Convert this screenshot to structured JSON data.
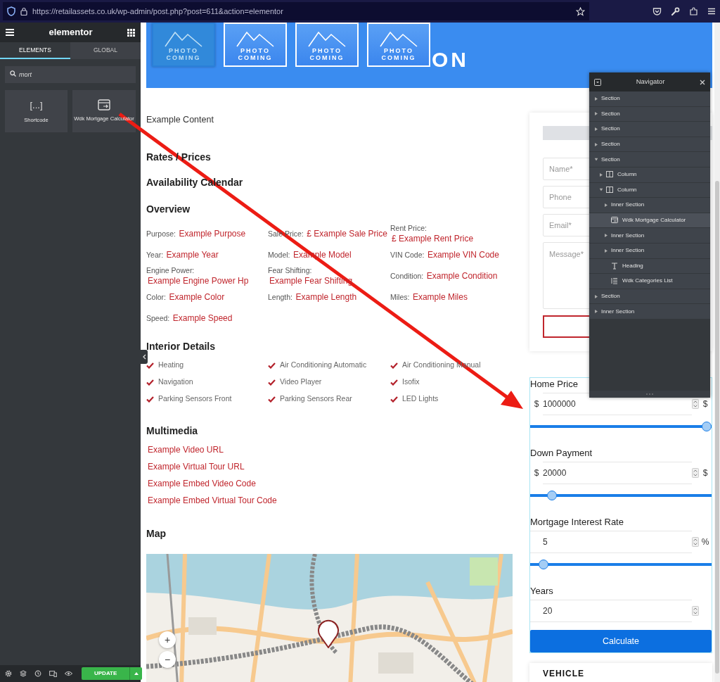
{
  "browser": {
    "url": "https://retailassets.co.uk/wp-admin/post.php?post=611&action=elementor"
  },
  "panel": {
    "logo": "elementor",
    "tabs": [
      {
        "label": "ELEMENTS",
        "selected": true
      },
      {
        "label": "GLOBAL",
        "selected": false
      }
    ],
    "search": {
      "value": "mort"
    },
    "widgets": [
      {
        "kind": "shortcode",
        "glyph": "[...]",
        "label": "Shortcode"
      },
      {
        "kind": "calculator",
        "label": "Wdk Mortgage Calculator"
      }
    ],
    "update_label": "UPDATE"
  },
  "banner": {
    "thumbnails": [
      {
        "caption": "PHOTO COMING",
        "selected": true
      },
      {
        "caption": "PHOTO COMING",
        "selected": false
      },
      {
        "caption": "PHOTO COMING",
        "selected": false
      },
      {
        "caption": "PHOTO COMING",
        "selected": false
      }
    ],
    "title_fragment": "ON"
  },
  "content": {
    "intro": "Example Content",
    "headings": [
      "Rates / Prices",
      "Availability Calendar"
    ],
    "overview": {
      "title": "Overview",
      "items": [
        {
          "kind": "inline",
          "label": "Purpose:",
          "value": "Example Purpose"
        },
        {
          "kind": "inline",
          "label": "Sale Price:",
          "value": "£ Example Sale Price"
        },
        {
          "kind": "stacked",
          "label": "Rent Price:",
          "value": "£ Example Rent Price"
        },
        {
          "kind": "inline",
          "label": "Year:",
          "value": "Example Year"
        },
        {
          "kind": "inline",
          "label": "Model:",
          "value": "Example Model"
        },
        {
          "kind": "inline",
          "label": "VIN Code:",
          "value": "Example VIN Code"
        },
        {
          "kind": "stacked",
          "label": "Engine Power:",
          "value": "Example Engine Power Hp"
        },
        {
          "kind": "stacked",
          "label": "Fear Shifting:",
          "value": "Example Fear Shifting"
        },
        {
          "kind": "inline",
          "label": "Condition:",
          "value": "Example Condition"
        },
        {
          "kind": "inline",
          "label": "Color:",
          "value": "Example Color"
        },
        {
          "kind": "inline",
          "label": "Length:",
          "value": "Example Length"
        },
        {
          "kind": "inline",
          "label": "Miles:",
          "value": "Example Miles"
        },
        {
          "kind": "inline",
          "label": "Speed:",
          "value": "Example Speed"
        }
      ]
    },
    "interior": {
      "title": "Interior Details",
      "features": [
        "Heating",
        "Air Conditioning Automatic",
        "Air Conditioning Manual",
        "Navigation",
        "Video Player",
        "Isofix",
        "Parking Sensors Front",
        "Parking Sensors Rear",
        "LED Lights"
      ]
    },
    "multimedia": {
      "title": "Multimedia",
      "links": [
        "Example Video URL",
        "Example Virtual Tour URL",
        "Example Embed Video Code",
        "Example Embed Virtual Tour Code"
      ]
    },
    "map": {
      "title": "Map",
      "zoom_controls": [
        "+",
        "−"
      ]
    }
  },
  "contact_form": {
    "fields": [
      {
        "kind": "input",
        "placeholder": "Name*"
      },
      {
        "kind": "input",
        "placeholder": "Phone"
      },
      {
        "kind": "input",
        "placeholder": "Email*"
      },
      {
        "kind": "textarea",
        "placeholder": "Message*"
      }
    ]
  },
  "calculator": {
    "fields": [
      {
        "label": "Home Price",
        "prefix": "$",
        "value": "1000000",
        "suffix": "$",
        "level": 1.0
      },
      {
        "label": "Down Payment",
        "prefix": "$",
        "value": "20000",
        "suffix": "$",
        "level": 0.1
      },
      {
        "label": "Mortgage Interest Rate",
        "value": "5",
        "suffix": "%",
        "level": 0.05
      },
      {
        "label": "Years",
        "value": "20"
      }
    ],
    "button": "Calculate"
  },
  "vehicle_card": {
    "title": "VEHICLE"
  },
  "navigator": {
    "title": "Navigator",
    "items": [
      {
        "kind": "section",
        "label": "Section",
        "expanded": false,
        "selected": false
      },
      {
        "kind": "section",
        "label": "Section",
        "expanded": false,
        "selected": false
      },
      {
        "kind": "section",
        "label": "Section",
        "expanded": false,
        "selected": false
      },
      {
        "kind": "section",
        "label": "Section",
        "expanded": false,
        "selected": false
      },
      {
        "kind": "section",
        "label": "Section",
        "expanded": true,
        "selected": false,
        "children": [
          {
            "kind": "column",
            "label": "Column",
            "expanded": false,
            "selected": false
          },
          {
            "kind": "column",
            "label": "Column",
            "expanded": true,
            "selected": false,
            "children": [
              {
                "kind": "section",
                "label": "Inner Section",
                "expanded": false,
                "selected": false
              },
              {
                "kind": "calculator",
                "label": "Wdk Mortgage Calculator",
                "selected": true
              },
              {
                "kind": "section",
                "label": "Inner Section",
                "expanded": false,
                "selected": false
              },
              {
                "kind": "section",
                "label": "Inner Section",
                "expanded": false,
                "selected": false
              },
              {
                "kind": "heading",
                "label": "Heading",
                "selected": false
              },
              {
                "kind": "list",
                "label": "Wdk Categories List",
                "selected": false
              }
            ]
          }
        ]
      },
      {
        "kind": "section",
        "label": "Section",
        "expanded": false,
        "selected": false
      },
      {
        "kind": "section",
        "label": "Inner Section",
        "expanded": false,
        "selected": false
      }
    ]
  }
}
